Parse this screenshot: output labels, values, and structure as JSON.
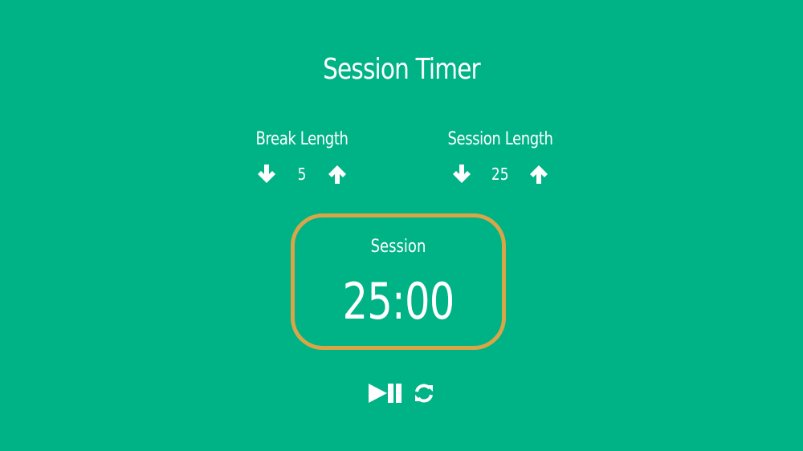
{
  "title": "Session Timer",
  "break": {
    "label": "Break Length",
    "value": "5",
    "decrement_icon": "arrow-down-icon",
    "increment_icon": "arrow-up-icon"
  },
  "session": {
    "label": "Session Length",
    "value": "25",
    "decrement_icon": "arrow-down-icon",
    "increment_icon": "arrow-up-icon"
  },
  "timer": {
    "label": "Session",
    "time": "25:00",
    "border_color": "#d8a548"
  },
  "actions": {
    "play_pause_icon": "play-pause-icon",
    "reset_icon": "refresh-icon"
  },
  "colors": {
    "background": "#00b386",
    "text": "#ffffff"
  }
}
